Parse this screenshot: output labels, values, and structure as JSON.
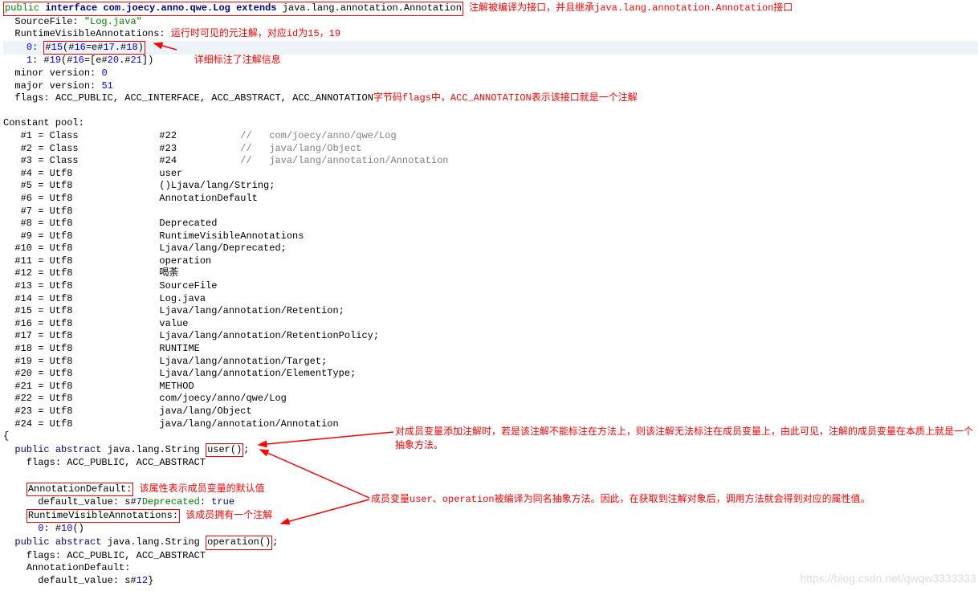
{
  "header": {
    "public": "public",
    "interface": "interface",
    "classname": "com.joecy.anno.qwe.Log",
    "extends": "extends",
    "superclass": "java.lang.annotation.Annotation",
    "ann1": "注解被编译为接口，并且继承java.lang.annotation.Annotation接口"
  },
  "sourcefile": {
    "label": "SourceFile:",
    "value": "\"Log.java\""
  },
  "rva": {
    "label": "RuntimeVisibleAnnotations:",
    "ann": "运行时可见的元注解，对应id为15，19"
  },
  "rva_line0": {
    "idx": "0",
    "p1": "15",
    "p2": "16",
    "p3": "17",
    "p4": "18"
  },
  "rva_line1": {
    "idx": "1",
    "p1": "19",
    "p2": "16",
    "p3": "20",
    "p4": "21"
  },
  "rva_ann2": "详细标注了注解信息",
  "minor": {
    "label": "minor version:",
    "value": "0"
  },
  "major": {
    "label": "major version:",
    "value": "51"
  },
  "flags": {
    "label": "flags:",
    "value": "ACC_PUBLIC, ACC_INTERFACE, ACC_ABSTRACT, ACC_ANNOTATION",
    "ann": "字节码flags中，ACC_ANNOTATION表示该接口就是一个注解"
  },
  "cp_header": "Constant pool:",
  "cp": [
    {
      "idx": "#1",
      "eq": "=",
      "type": "Class",
      "ref": "#22",
      "sep": "//",
      "val": "com/joecy/anno/qwe/Log"
    },
    {
      "idx": "#2",
      "eq": "=",
      "type": "Class",
      "ref": "#23",
      "sep": "//",
      "val": "java/lang/Object"
    },
    {
      "idx": "#3",
      "eq": "=",
      "type": "Class",
      "ref": "#24",
      "sep": "//",
      "val": "java/lang/annotation/Annotation"
    },
    {
      "idx": "#4",
      "eq": "=",
      "type": "Utf8",
      "ref": "user"
    },
    {
      "idx": "#5",
      "eq": "=",
      "type": "Utf8",
      "ref": "()Ljava/lang/String;"
    },
    {
      "idx": "#6",
      "eq": "=",
      "type": "Utf8",
      "ref": "AnnotationDefault"
    },
    {
      "idx": "#7",
      "eq": "=",
      "type": "Utf8",
      "ref": ""
    },
    {
      "idx": "#8",
      "eq": "=",
      "type": "Utf8",
      "ref": "Deprecated"
    },
    {
      "idx": "#9",
      "eq": "=",
      "type": "Utf8",
      "ref": "RuntimeVisibleAnnotations"
    },
    {
      "idx": "#10",
      "eq": "=",
      "type": "Utf8",
      "ref": "Ljava/lang/Deprecated;"
    },
    {
      "idx": "#11",
      "eq": "=",
      "type": "Utf8",
      "ref": "operation"
    },
    {
      "idx": "#12",
      "eq": "=",
      "type": "Utf8",
      "ref": "喝荼"
    },
    {
      "idx": "#13",
      "eq": "=",
      "type": "Utf8",
      "ref": "SourceFile"
    },
    {
      "idx": "#14",
      "eq": "=",
      "type": "Utf8",
      "ref": "Log.java"
    },
    {
      "idx": "#15",
      "eq": "=",
      "type": "Utf8",
      "ref": "Ljava/lang/annotation/Retention;"
    },
    {
      "idx": "#16",
      "eq": "=",
      "type": "Utf8",
      "ref": "value"
    },
    {
      "idx": "#17",
      "eq": "=",
      "type": "Utf8",
      "ref": "Ljava/lang/annotation/RetentionPolicy;"
    },
    {
      "idx": "#18",
      "eq": "=",
      "type": "Utf8",
      "ref": "RUNTIME"
    },
    {
      "idx": "#19",
      "eq": "=",
      "type": "Utf8",
      "ref": "Ljava/lang/annotation/Target;"
    },
    {
      "idx": "#20",
      "eq": "=",
      "type": "Utf8",
      "ref": "Ljava/lang/annotation/ElementType;"
    },
    {
      "idx": "#21",
      "eq": "=",
      "type": "Utf8",
      "ref": "METHOD"
    },
    {
      "idx": "#22",
      "eq": "=",
      "type": "Utf8",
      "ref": "com/joecy/anno/qwe/Log"
    },
    {
      "idx": "#23",
      "eq": "=",
      "type": "Utf8",
      "ref": "java/lang/Object"
    },
    {
      "idx": "#24",
      "eq": "=",
      "type": "Utf8",
      "ref": "java/lang/annotation/Annotation"
    }
  ],
  "method_user": {
    "sig_pub": "public",
    "sig_abs": "abstract",
    "sig_ret": "java.lang.String",
    "sig_name": "user()",
    "sig_semicolon": ";",
    "flags": "flags: ACC_PUBLIC, ACC_ABSTRACT",
    "adlabel": "AnnotationDefault:",
    "adann": "该属性表示成员变量的默认值",
    "dv_label": "default_value:",
    "dv_s": "s#",
    "dv_num": "7",
    "dep": "Deprecated",
    "true": "true",
    "rvalabel": "RuntimeVisibleAnnotations:",
    "rvaann": "该成员拥有一个注解",
    "rva0_idx": "0",
    "rva0_num": "10"
  },
  "method_op": {
    "sig_pub": "public",
    "sig_abs": "abstract",
    "sig_ret": "java.lang.String",
    "sig_name": "operation()",
    "sig_semicolon": ";",
    "flags": "flags: ACC_PUBLIC, ACC_ABSTRACT",
    "adlabel": "AnnotationDefault:",
    "dv_label": "default_value:",
    "dv_s": "s#",
    "dv_num": "12",
    "close": "}"
  },
  "side_ann1": "对成员变量添加注解时，若是该注解不能标注在方法上，则该注解无法标注在成员变量上，由此可见，注解的成员变量在本质上就是一个抽象方法。",
  "side_ann2": "成员变量user、operation被编译为同名抽象方法。因此，在获取到注解对象后，调用方法就会得到对应的属性值。",
  "watermark": "https://blog.csdn.net/qwqw3333333"
}
